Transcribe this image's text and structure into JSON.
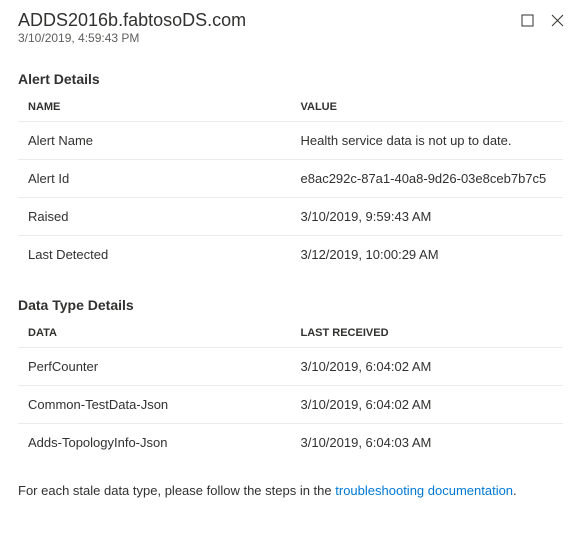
{
  "header": {
    "title": "ADDS2016b.fabtosoDS.com",
    "timestamp": "3/10/2019, 4:59:43 PM"
  },
  "alert_section": {
    "title": "Alert Details",
    "columns": {
      "name": "NAME",
      "value": "VALUE"
    },
    "rows": [
      {
        "name": "Alert Name",
        "value": "Health service data is not up to date."
      },
      {
        "name": "Alert Id",
        "value": "e8ac292c-87a1-40a8-9d26-03e8ceb7b7c5"
      },
      {
        "name": "Raised",
        "value": "3/10/2019, 9:59:43 AM"
      },
      {
        "name": "Last Detected",
        "value": "3/12/2019, 10:00:29 AM"
      }
    ]
  },
  "data_section": {
    "title": "Data Type Details",
    "columns": {
      "data": "DATA",
      "last_received": "LAST RECEIVED"
    },
    "rows": [
      {
        "data": "PerfCounter",
        "last_received": "3/10/2019, 6:04:02 AM"
      },
      {
        "data": "Common-TestData-Json",
        "last_received": "3/10/2019, 6:04:02 AM"
      },
      {
        "data": "Adds-TopologyInfo-Json",
        "last_received": "3/10/2019, 6:04:03 AM"
      }
    ]
  },
  "footer": {
    "prefix": "For each stale data type, please follow the steps in the ",
    "link_text": "troubleshooting documentation",
    "suffix": "."
  }
}
